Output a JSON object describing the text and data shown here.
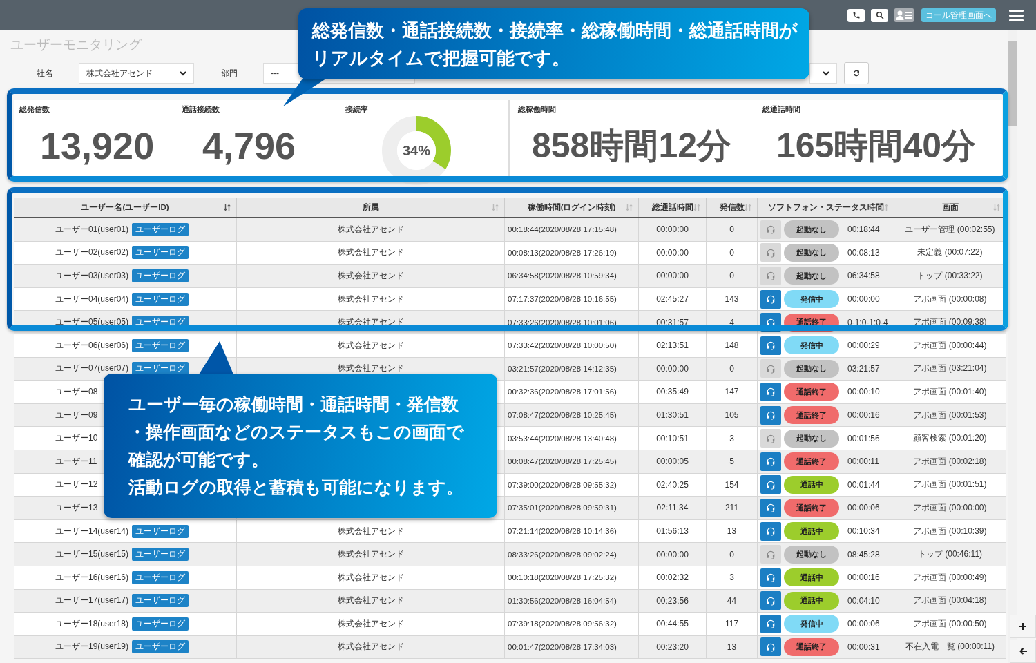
{
  "header": {
    "call_button": "コール管理画面へ"
  },
  "page_title": "ユーザーモニタリング",
  "filters": [
    {
      "label": "社名",
      "value": "株式会社アセンド"
    },
    {
      "label": "部門",
      "value": "---"
    }
  ],
  "stat_groups": [
    [
      {
        "kind": "number",
        "label": "総発信数",
        "value": "13,920"
      },
      {
        "kind": "number",
        "label": "通話接続数",
        "value": "4,796"
      },
      {
        "kind": "donut",
        "label": "接続率",
        "level": 0.34,
        "reading": "34%"
      }
    ],
    [
      {
        "kind": "number",
        "label": "総稼働時間",
        "value": "858時間12分"
      },
      {
        "kind": "number",
        "label": "総通話時間",
        "value": "165時間40分"
      }
    ]
  ],
  "table": {
    "columns": [
      {
        "label": "ユーザー名(ユーザーID)",
        "sorted": true
      },
      {
        "label": "所属",
        "sorted": false
      },
      {
        "label": "稼働時間(ログイン時刻)",
        "sorted": false
      },
      {
        "label": "総通話時間",
        "sorted": false
      },
      {
        "label": "発信数",
        "sorted": false
      },
      {
        "label": "ソフトフォン・ステータス時間",
        "sorted": false
      },
      {
        "label": "画面",
        "sorted": false
      }
    ],
    "rows": [
      {
        "name": "ユーザー01(user01)",
        "log_button": "ユーザーログ",
        "department": "株式会社アセンド",
        "uptime": "00:18:44(2020/08/28 17:15:48)",
        "talk_time": "00:00:00",
        "calls": "0",
        "softphone_on": false,
        "status": {
          "kind": "idle",
          "label": "起動なし"
        },
        "status_time": "00:18:44",
        "screen": "ユーザー管理 (00:02:55)"
      },
      {
        "name": "ユーザー02(user02)",
        "log_button": "ユーザーログ",
        "department": "株式会社アセンド",
        "uptime": "00:08:13(2020/08/28 17:26:19)",
        "talk_time": "00:00:00",
        "calls": "0",
        "softphone_on": false,
        "status": {
          "kind": "idle",
          "label": "起動なし"
        },
        "status_time": "00:08:13",
        "screen": "未定義 (00:07:22)"
      },
      {
        "name": "ユーザー03(user03)",
        "log_button": "ユーザーログ",
        "department": "株式会社アセンド",
        "uptime": "06:34:58(2020/08/28 10:59:34)",
        "talk_time": "00:00:00",
        "calls": "0",
        "softphone_on": false,
        "status": {
          "kind": "idle",
          "label": "起動なし"
        },
        "status_time": "06:34:58",
        "screen": "トップ (00:33:22)"
      },
      {
        "name": "ユーザー04(user04)",
        "log_button": "ユーザーログ",
        "department": "株式会社アセンド",
        "uptime": "07:17:37(2020/08/28 10:16:55)",
        "talk_time": "02:45:27",
        "calls": "143",
        "softphone_on": true,
        "status": {
          "kind": "dialing",
          "label": "発信中"
        },
        "status_time": "00:00:00",
        "screen": "アポ画面 (00:00:08)"
      },
      {
        "name": "ユーザー05(user05)",
        "log_button": "ユーザーログ",
        "department": "株式会社アセンド",
        "uptime": "07:33:26(2020/08/28 10:01:06)",
        "talk_time": "00:31:57",
        "calls": "4",
        "softphone_on": true,
        "status": {
          "kind": "ended",
          "label": "通話終了"
        },
        "status_time": "0-1:0-1:0-4",
        "screen": "アポ画面 (00:09:38)"
      },
      {
        "name": "ユーザー06(user06)",
        "log_button": "ユーザーログ",
        "department": "株式会社アセンド",
        "uptime": "07:33:42(2020/08/28 10:00:50)",
        "talk_time": "02:13:51",
        "calls": "148",
        "softphone_on": true,
        "status": {
          "kind": "dialing",
          "label": "発信中"
        },
        "status_time": "00:00:29",
        "screen": "アポ画面 (00:00:44)"
      },
      {
        "name": "ユーザー07(user07)",
        "log_button": "ユーザーログ",
        "department": "株式会社アセンド",
        "uptime": "03:21:57(2020/08/28 14:12:35)",
        "talk_time": "00:00:00",
        "calls": "0",
        "softphone_on": false,
        "status": {
          "kind": "idle",
          "label": "起動なし"
        },
        "status_time": "03:21:57",
        "screen": "アポ画面 (03:21:04)"
      },
      {
        "name": "ユーザー08",
        "uptime": "00:32:36(2020/08/28 17:01:56)",
        "talk_time": "00:35:49",
        "calls": "147",
        "softphone_on": true,
        "status": {
          "kind": "ended",
          "label": "通話終了"
        },
        "status_time": "00:00:10",
        "screen": "アポ画面 (00:01:40)"
      },
      {
        "name": "ユーザー09",
        "uptime": "07:08:47(2020/08/28 10:25:45)",
        "talk_time": "01:30:51",
        "calls": "105",
        "softphone_on": true,
        "status": {
          "kind": "ended",
          "label": "通話終了"
        },
        "status_time": "00:00:16",
        "screen": "アポ画面 (00:01:53)"
      },
      {
        "name": "ユーザー10",
        "uptime": "03:53:44(2020/08/28 13:40:48)",
        "talk_time": "00:10:51",
        "calls": "3",
        "softphone_on": false,
        "status": {
          "kind": "idle",
          "label": "起動なし"
        },
        "status_time": "00:01:56",
        "screen": "顧客検索 (00:01:20)"
      },
      {
        "name": "ユーザー11",
        "uptime": "00:08:47(2020/08/28 17:25:45)",
        "talk_time": "00:00:05",
        "calls": "5",
        "softphone_on": true,
        "status": {
          "kind": "ended",
          "label": "通話終了"
        },
        "status_time": "00:00:11",
        "screen": "アポ画面 (00:02:18)"
      },
      {
        "name": "ユーザー12",
        "uptime": "07:39:00(2020/08/28 09:55:32)",
        "talk_time": "02:40:25",
        "calls": "154",
        "softphone_on": true,
        "status": {
          "kind": "talking",
          "label": "通話中"
        },
        "status_time": "00:01:44",
        "screen": "アポ画面 (00:01:51)"
      },
      {
        "name": "ユーザー13",
        "uptime": "07:35:01(2020/08/28 09:59:31)",
        "talk_time": "02:11:34",
        "calls": "211",
        "softphone_on": true,
        "status": {
          "kind": "ended",
          "label": "通話終了"
        },
        "status_time": "00:00:06",
        "screen": "アポ画面 (00:00:00)"
      },
      {
        "name": "ユーザー14(user14)",
        "log_button": "ユーザーログ",
        "department": "株式会社アセンド",
        "uptime": "07:21:14(2020/08/28 10:14:36)",
        "talk_time": "01:56:13",
        "calls": "13",
        "softphone_on": true,
        "status": {
          "kind": "talking",
          "label": "通話中"
        },
        "status_time": "00:10:34",
        "screen": "アポ画面 (00:10:39)"
      },
      {
        "name": "ユーザー15(user15)",
        "log_button": "ユーザーログ",
        "department": "株式会社アセンド",
        "uptime": "08:33:26(2020/08/28 09:02:24)",
        "talk_time": "00:00:00",
        "calls": "0",
        "softphone_on": false,
        "status": {
          "kind": "idle",
          "label": "起動なし"
        },
        "status_time": "08:45:28",
        "screen": "トップ (00:46:11)"
      },
      {
        "name": "ユーザー16(user16)",
        "log_button": "ユーザーログ",
        "department": "株式会社アセンド",
        "uptime": "00:10:18(2020/08/28 17:25:32)",
        "talk_time": "00:02:32",
        "calls": "3",
        "softphone_on": true,
        "status": {
          "kind": "talking",
          "label": "通話中"
        },
        "status_time": "00:00:16",
        "screen": "アポ画面 (00:00:49)"
      },
      {
        "name": "ユーザー17(user17)",
        "log_button": "ユーザーログ",
        "department": "株式会社アセンド",
        "uptime": "01:30:56(2020/08/28 16:04:54)",
        "talk_time": "00:23:56",
        "calls": "44",
        "softphone_on": true,
        "status": {
          "kind": "talking",
          "label": "通話中"
        },
        "status_time": "00:04:10",
        "screen": "アポ画面 (00:04:18)"
      },
      {
        "name": "ユーザー18(user18)",
        "log_button": "ユーザーログ",
        "department": "株式会社アセンド",
        "uptime": "07:39:18(2020/08/28 09:56:32)",
        "talk_time": "00:44:55",
        "calls": "117",
        "softphone_on": true,
        "status": {
          "kind": "dialing",
          "label": "発信中"
        },
        "status_time": "00:00:06",
        "screen": "アポ画面 (00:00:50)"
      },
      {
        "name": "ユーザー19(user19)",
        "log_button": "ユーザーログ",
        "department": "株式会社アセンド",
        "uptime": "00:01:47(2020/08/28 17:34:03)",
        "talk_time": "00:23:20",
        "calls": "13",
        "softphone_on": true,
        "status": {
          "kind": "ended",
          "label": "通話終了"
        },
        "status_time": "00:00:31",
        "screen": "不在入電一覧 (00:00:11)"
      }
    ]
  },
  "callouts": [
    {
      "lines": [
        "総発信数・通話接続数・接続率・総稼働時間・総通話時間が",
        "リアルタイムで把握可能です。"
      ]
    },
    {
      "lines": [
        "ユーザー毎の稼働時間・通話時間・発信数",
        "・操作画面などのステータスもこの画面で",
        "確認が可能です。",
        "活動ログの取得と蓄積も可能になります。"
      ]
    }
  ]
}
